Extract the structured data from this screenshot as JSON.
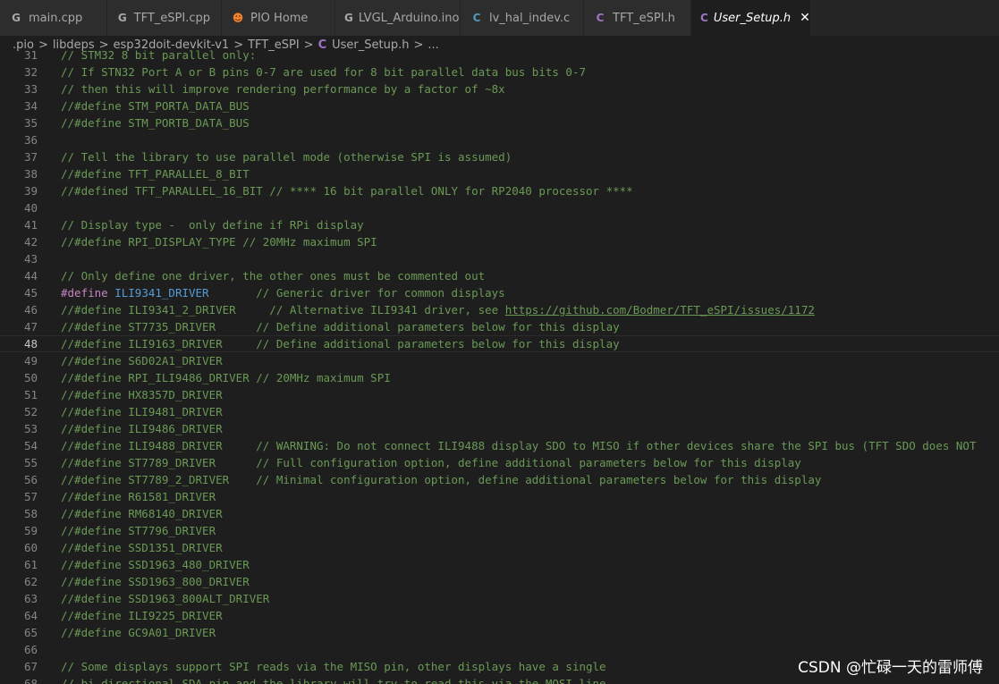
{
  "tabs": [
    {
      "label": "main.cpp",
      "icon": "G",
      "icon_name": "cpp-file-icon",
      "icon_color": "#a8a8a8",
      "active": false
    },
    {
      "label": "TFT_eSPI.cpp",
      "icon": "G",
      "icon_name": "cpp-file-icon",
      "icon_color": "#a8a8a8",
      "active": false
    },
    {
      "label": "PIO Home",
      "icon": "☻",
      "icon_name": "platformio-icon",
      "icon_color": "#f5822a",
      "active": false
    },
    {
      "label": "LVGL_Arduino.ino",
      "icon": "G",
      "icon_name": "ino-file-icon",
      "icon_color": "#a8a8a8",
      "active": false
    },
    {
      "label": "lv_hal_indev.c",
      "icon": "C",
      "icon_name": "c-file-icon",
      "icon_color": "#519aba",
      "active": false
    },
    {
      "label": "TFT_eSPI.h",
      "icon": "C",
      "icon_name": "h-file-icon",
      "icon_color": "#a074c4",
      "active": false
    },
    {
      "label": "User_Setup.h",
      "icon": "C",
      "icon_name": "h-file-icon",
      "icon_color": "#a074c4",
      "active": true,
      "close": "✕"
    }
  ],
  "breadcrumb": {
    "parts": [
      ".pio",
      "libdeps",
      "esp32doit-devkit-v1",
      "TFT_eSPI"
    ],
    "file_icon": "C",
    "file": "User_Setup.h",
    "tail": "...",
    "separator": ">"
  },
  "code_lines": [
    {
      "n": "31",
      "text": "// STM32 8 bit parallel only:"
    },
    {
      "n": "32",
      "text": "// If STN32 Port A or B pins 0-7 are used for 8 bit parallel data bus bits 0-7"
    },
    {
      "n": "33",
      "text": "// then this will improve rendering performance by a factor of ~8x"
    },
    {
      "n": "34",
      "text": "//#define STM_PORTA_DATA_BUS"
    },
    {
      "n": "35",
      "text": "//#define STM_PORTB_DATA_BUS"
    },
    {
      "n": "36",
      "text": ""
    },
    {
      "n": "37",
      "text": "// Tell the library to use parallel mode (otherwise SPI is assumed)"
    },
    {
      "n": "38",
      "text": "//#define TFT_PARALLEL_8_BIT"
    },
    {
      "n": "39",
      "text": "//#defined TFT_PARALLEL_16_BIT // **** 16 bit parallel ONLY for RP2040 processor ****"
    },
    {
      "n": "40",
      "text": ""
    },
    {
      "n": "41",
      "text": "// Display type -  only define if RPi display"
    },
    {
      "n": "42",
      "text": "//#define RPI_DISPLAY_TYPE // 20MHz maximum SPI"
    },
    {
      "n": "43",
      "text": ""
    },
    {
      "n": "44",
      "text": "// Only define one driver, the other ones must be commented out"
    },
    {
      "n": "45",
      "active_define": true,
      "kw": "#define",
      "macro": "ILI9341_DRIVER",
      "comment": "       // Generic driver for common displays"
    },
    {
      "n": "46",
      "text": "//#define ILI9341_2_DRIVER     // Alternative ILI9341 driver, see ",
      "link": "https://github.com/Bodmer/TFT_eSPI/issues/1172"
    },
    {
      "n": "47",
      "text": "//#define ST7735_DRIVER      // Define additional parameters below for this display"
    },
    {
      "n": "48",
      "text": "//#define ILI9163_DRIVER     // Define additional parameters below for this display",
      "current": true
    },
    {
      "n": "49",
      "text": "//#define S6D02A1_DRIVER"
    },
    {
      "n": "50",
      "text": "//#define RPI_ILI9486_DRIVER // 20MHz maximum SPI"
    },
    {
      "n": "51",
      "text": "//#define HX8357D_DRIVER"
    },
    {
      "n": "52",
      "text": "//#define ILI9481_DRIVER"
    },
    {
      "n": "53",
      "text": "//#define ILI9486_DRIVER"
    },
    {
      "n": "54",
      "text": "//#define ILI9488_DRIVER     // WARNING: Do not connect ILI9488 display SDO to MISO if other devices share the SPI bus (TFT SDO does NOT"
    },
    {
      "n": "55",
      "text": "//#define ST7789_DRIVER      // Full configuration option, define additional parameters below for this display"
    },
    {
      "n": "56",
      "text": "//#define ST7789_2_DRIVER    // Minimal configuration option, define additional parameters below for this display"
    },
    {
      "n": "57",
      "text": "//#define R61581_DRIVER"
    },
    {
      "n": "58",
      "text": "//#define RM68140_DRIVER"
    },
    {
      "n": "59",
      "text": "//#define ST7796_DRIVER"
    },
    {
      "n": "60",
      "text": "//#define SSD1351_DRIVER"
    },
    {
      "n": "61",
      "text": "//#define SSD1963_480_DRIVER"
    },
    {
      "n": "62",
      "text": "//#define SSD1963_800_DRIVER"
    },
    {
      "n": "63",
      "text": "//#define SSD1963_800ALT_DRIVER"
    },
    {
      "n": "64",
      "text": "//#define ILI9225_DRIVER"
    },
    {
      "n": "65",
      "text": "//#define GC9A01_DRIVER"
    },
    {
      "n": "66",
      "text": ""
    },
    {
      "n": "67",
      "text": "// Some displays support SPI reads via the MISO pin, other displays have a single"
    },
    {
      "n": "68",
      "text": "// bi-directional SDA pin and the library will try to read this via the MOSI line."
    }
  ],
  "watermark": "CSDN @忙碌一天的雷师傅",
  "colors": {
    "comment": "#6a9955",
    "keyword": "#c586c0",
    "macro": "#569cd6",
    "line_number": "#858585",
    "background": "#1e1e1e"
  }
}
